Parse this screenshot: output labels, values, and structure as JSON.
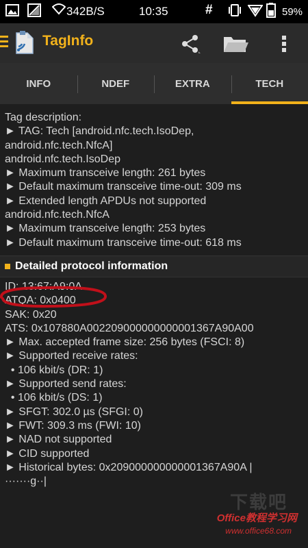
{
  "status_bar": {
    "speed": "342B/S",
    "time": "10:35",
    "hash": "#",
    "battery": "59%"
  },
  "app_bar": {
    "title": "TagInfo",
    "icons": [
      "menu-icon",
      "taginfo-logo",
      "share-icon",
      "folder-icon",
      "overflow-icon"
    ]
  },
  "tabs": [
    {
      "label": "INFO",
      "active": false
    },
    {
      "label": "NDEF",
      "active": false
    },
    {
      "label": "EXTRA",
      "active": false
    },
    {
      "label": "TECH",
      "active": true
    }
  ],
  "tech": {
    "lines": [
      "Tag description:",
      "► TAG: Tech [android.nfc.tech.IsoDep,",
      "android.nfc.tech.NfcA]",
      "android.nfc.tech.IsoDep",
      "► Maximum transceive length: 261 bytes",
      "► Default maximum transceive time-out: 309 ms",
      "► Extended length APDUs not supported",
      "android.nfc.tech.NfcA",
      "► Maximum transceive length: 253 bytes",
      "► Default maximum transceive time-out: 618 ms"
    ]
  },
  "protocol": {
    "header": "Detailed protocol information",
    "lines": [
      "ID: 13:67:A9:0A",
      "ATQA: 0x0400",
      "SAK: 0x20",
      "ATS: 0x107880A002209000000000001367A90A00",
      "► Max. accepted frame size: 256 bytes (FSCI: 8)",
      "► Supported receive rates:",
      "  • 106 kbit/s (DR: 1)",
      "► Supported send rates:",
      "  • 106 kbit/s (DS: 1)",
      "► SFGT: 302.0 µs  (SFGI: 0)",
      "► FWT: 309.3 ms  (FWI: 10)",
      "► NAD not supported",
      "► CID supported",
      "► Historical bytes: 0x209000000000001367A90A |",
      "·······g··|"
    ]
  },
  "watermark": {
    "big": "下载吧",
    "text": "Office教程学习网",
    "url": "www.office68.com"
  },
  "colors": {
    "accent": "#f2b21b",
    "background": "#1e1e1e",
    "annotation": "#c0101a"
  }
}
